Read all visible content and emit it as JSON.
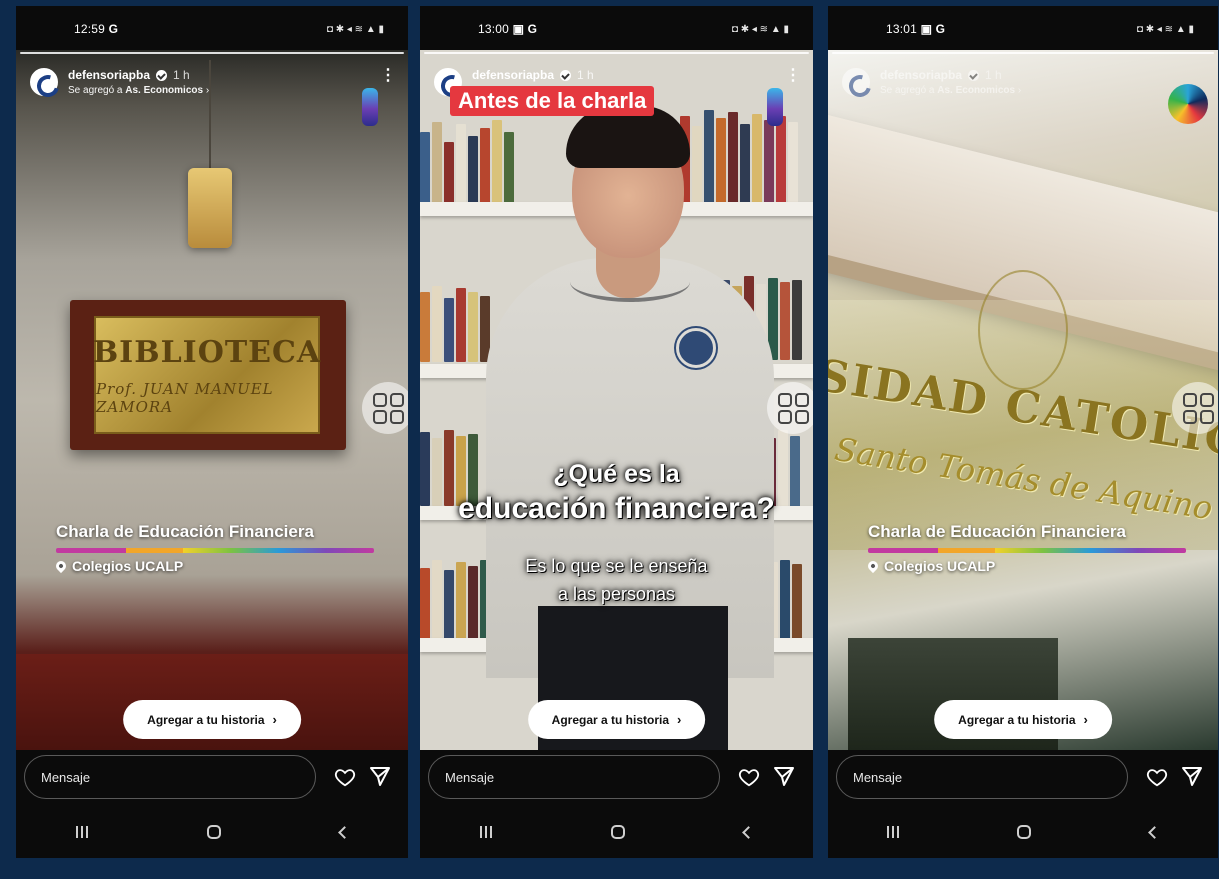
{
  "screens": [
    {
      "status_time": "12:59",
      "status_left_icons": "G",
      "account": "defensoriapba",
      "post_age": "1 h",
      "added_prefix": "Se agregó a ",
      "added_highlight": "As. Economicos",
      "added_suffix": " ›",
      "location_title": "Charla de Educación Financiera",
      "location_place": "Colegios UCALP",
      "plaque_line1": "BIBLIOTECA",
      "plaque_line2": "Prof. JUAN MANUEL ZAMORA",
      "add_to_story": "Agregar a tu historia",
      "message_placeholder": "Mensaje"
    },
    {
      "status_time": "13:00",
      "status_left_icons": "▣ G",
      "account": "defensoriapba",
      "post_age": "1 h",
      "story_tag": "Antes de la charla",
      "caption_line1": "¿Qué es la",
      "caption_line2": "educación financiera?",
      "caption_line3": "Es lo que se le enseña",
      "caption_line4": "a las personas",
      "add_to_story": "Agregar a tu historia",
      "message_placeholder": "Mensaje"
    },
    {
      "status_time": "13:01",
      "status_left_icons": "▣ G",
      "account": "defensoriapba",
      "post_age": "1 h",
      "added_prefix": "Se agregó a ",
      "added_highlight": "As. Economicos",
      "added_suffix": " ›",
      "facade_line1": "SIDAD CATOLICA DE LA P",
      "facade_line2": "Santo Tomás de Aquino",
      "location_title": "Charla de Educación Financiera",
      "location_place": "Colegios UCALP",
      "add_to_story": "Agregar a tu historia",
      "message_placeholder": "Mensaje"
    }
  ],
  "status_right_icons": "◘ ✱ ◂ ≋ ▲ ▮",
  "colors": {
    "background": "#0d2a4c",
    "tag_red": "#e5383f",
    "brand_blue": "#1c3f85"
  },
  "icons": [
    "avatar-logo",
    "verified-icon",
    "more-icon",
    "brand-sticker",
    "grid-icon",
    "location-pin-icon",
    "chevron-right-icon",
    "heart-icon",
    "send-icon",
    "recent-apps-icon",
    "home-icon",
    "back-icon"
  ]
}
